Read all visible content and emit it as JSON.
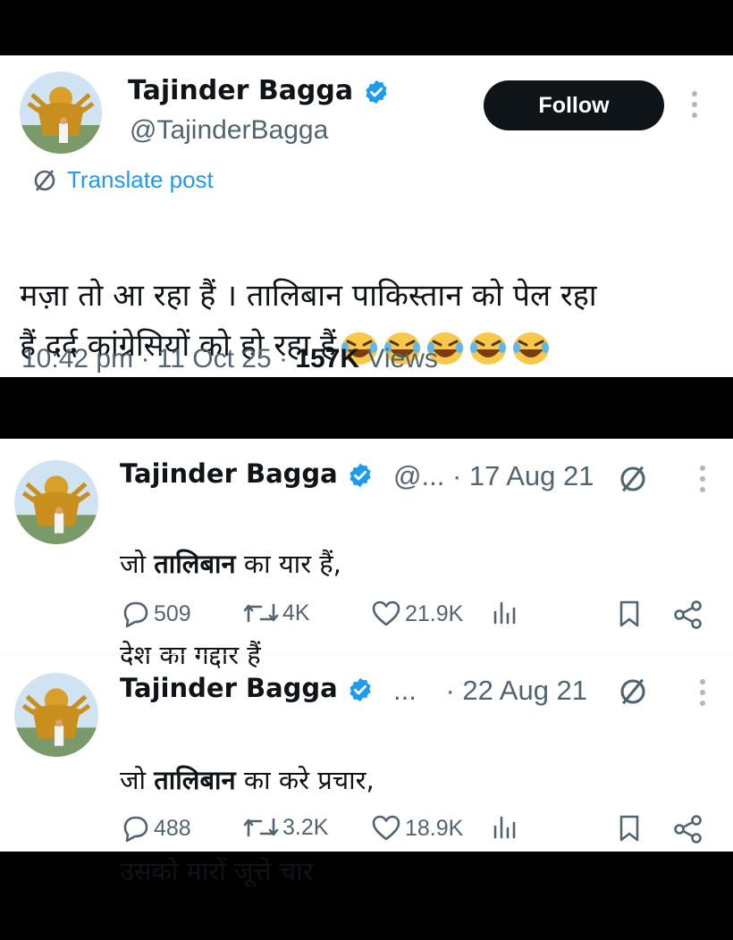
{
  "main_post": {
    "author_name": "Tajinder Bagga",
    "handle": "@TajinderBagga",
    "follow_label": "Follow",
    "translate_label": "Translate post",
    "text": "मज़ा तो आ रहा हैं । तालिबान पाकिस्तान को पेल रहा\nहैं दर्द कांग्रेसियों को हो रहा हैं",
    "time": "10:42 pm",
    "date": "11 Oct 25",
    "views_count": "157K",
    "views_label": "Views"
  },
  "old_tweets": [
    {
      "author_name": "Tajinder Bagga",
      "handle_truncated": "@...",
      "date": "· 17 Aug 21",
      "line1_pre": "जो ",
      "line1_bold": "तालिबान",
      "line1_post": " का यार हैं,",
      "line2": "देश का गद्दार हैं",
      "replies": "509",
      "reposts": "4K",
      "likes": "21.9K"
    },
    {
      "author_name": "Tajinder Bagga",
      "handle_truncated": "...",
      "date": "· 22 Aug 21",
      "line1_pre": "जो ",
      "line1_bold": "तालिबान",
      "line1_post": " का करे प्रचार,",
      "line2": "उसको मारों जूत्ते चार",
      "replies": "488",
      "reposts": "3.2K",
      "likes": "18.9K"
    }
  ],
  "colors": {
    "verified": "#1d9bf0",
    "text": "#0f1419",
    "muted": "#536471",
    "link": "#1d9bf0"
  }
}
